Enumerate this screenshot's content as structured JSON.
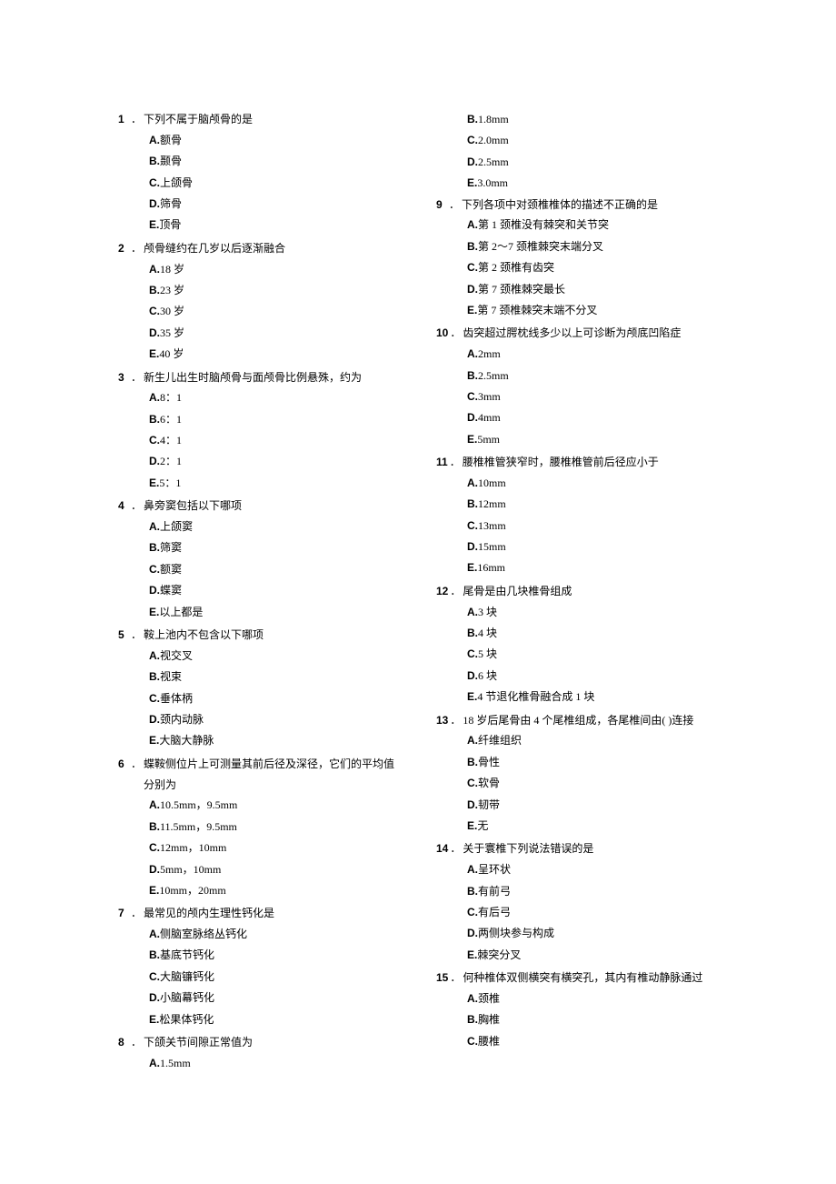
{
  "left": [
    {
      "num": "1",
      "stem": "下列不属于脑颅骨的是",
      "opts": [
        "额骨",
        "颞骨",
        "上颌骨",
        "筛骨",
        "顶骨"
      ]
    },
    {
      "num": "2",
      "stem": "颅骨缝约在几岁以后逐渐融合",
      "opts": [
        "18 岁",
        "23 岁",
        "30 岁",
        "35 岁",
        "40 岁"
      ]
    },
    {
      "num": "3",
      "stem": "新生儿出生时脑颅骨与面颅骨比例悬殊，约为",
      "opts": [
        "8：1",
        "6：1",
        "4：1",
        "2：1",
        "5：1"
      ]
    },
    {
      "num": "4",
      "stem": "鼻旁窦包括以下哪项",
      "opts": [
        "上颌窦",
        "筛窦",
        "额窦",
        "蝶窦",
        "以上都是"
      ]
    },
    {
      "num": "5",
      "stem": "鞍上池内不包含以下哪项",
      "opts": [
        "视交叉",
        "视束",
        "垂体柄",
        "颈内动脉",
        "大脑大静脉"
      ]
    },
    {
      "num": "6",
      "stem": "蝶鞍侧位片上可测量其前后径及深径，它们的平均值分别为",
      "opts": [
        "10.5mm，9.5mm",
        "11.5mm，9.5mm",
        "12mm，10mm",
        "5mm，10mm",
        "10mm，20mm"
      ]
    },
    {
      "num": "7",
      "stem": "最常见的颅内生理性钙化是",
      "opts": [
        "侧脑室脉络丛钙化",
        "基底节钙化",
        "大脑镰钙化",
        "小脑幕钙化",
        "松果体钙化"
      ]
    },
    {
      "num": "8",
      "stem": "下颌关节间隙正常值为",
      "opts": [
        "1.5mm"
      ]
    }
  ],
  "right_continuation_opts": [
    "1.8mm",
    "2.0mm",
    "2.5mm",
    "3.0mm"
  ],
  "right_continuation_letters": [
    "B.",
    "C.",
    "D.",
    "E."
  ],
  "right": [
    {
      "num": "9",
      "stem": "下列各项中对颈椎椎体的描述不正确的是",
      "opts": [
        "第 1 颈椎没有棘突和关节突",
        "第 2～7 颈椎棘突末端分叉",
        "第 2 颈椎有齿突",
        "第 7 颈椎棘突最长",
        "第 7 颈椎棘突末端不分叉"
      ]
    },
    {
      "num": "10",
      "stem": "齿突超过腭枕线多少以上可诊断为颅底凹陷症",
      "opts": [
        "2mm",
        "2.5mm",
        "3mm",
        "4mm",
        "5mm"
      ]
    },
    {
      "num": "11",
      "stem": "腰椎椎管狭窄时，腰椎椎管前后径应小于",
      "opts": [
        "10mm",
        "12mm",
        "13mm",
        "15mm",
        "16mm"
      ]
    },
    {
      "num": "12",
      "stem": "尾骨是由几块椎骨组成",
      "opts": [
        "3 块",
        "4 块",
        "5 块",
        "6 块",
        "4 节退化椎骨融合成 1 块"
      ]
    },
    {
      "num": "13",
      "stem": "18 岁后尾骨由 4 个尾椎组成，各尾椎间由( )连接",
      "opts": [
        "纤维组织",
        "骨性",
        "软骨",
        "韧带",
        "无"
      ]
    },
    {
      "num": "14",
      "stem": "关于寰椎下列说法错误的是",
      "opts": [
        "呈环状",
        "有前弓",
        "有后弓",
        "两侧块参与构成",
        "棘突分叉"
      ]
    },
    {
      "num": "15",
      "stem": "何种椎体双侧横突有横突孔，其内有椎动静脉通过",
      "opts": [
        "颈椎",
        "胸椎",
        "腰椎"
      ]
    }
  ],
  "letters": [
    "A.",
    "B.",
    "C.",
    "D.",
    "E."
  ],
  "sep": "．"
}
